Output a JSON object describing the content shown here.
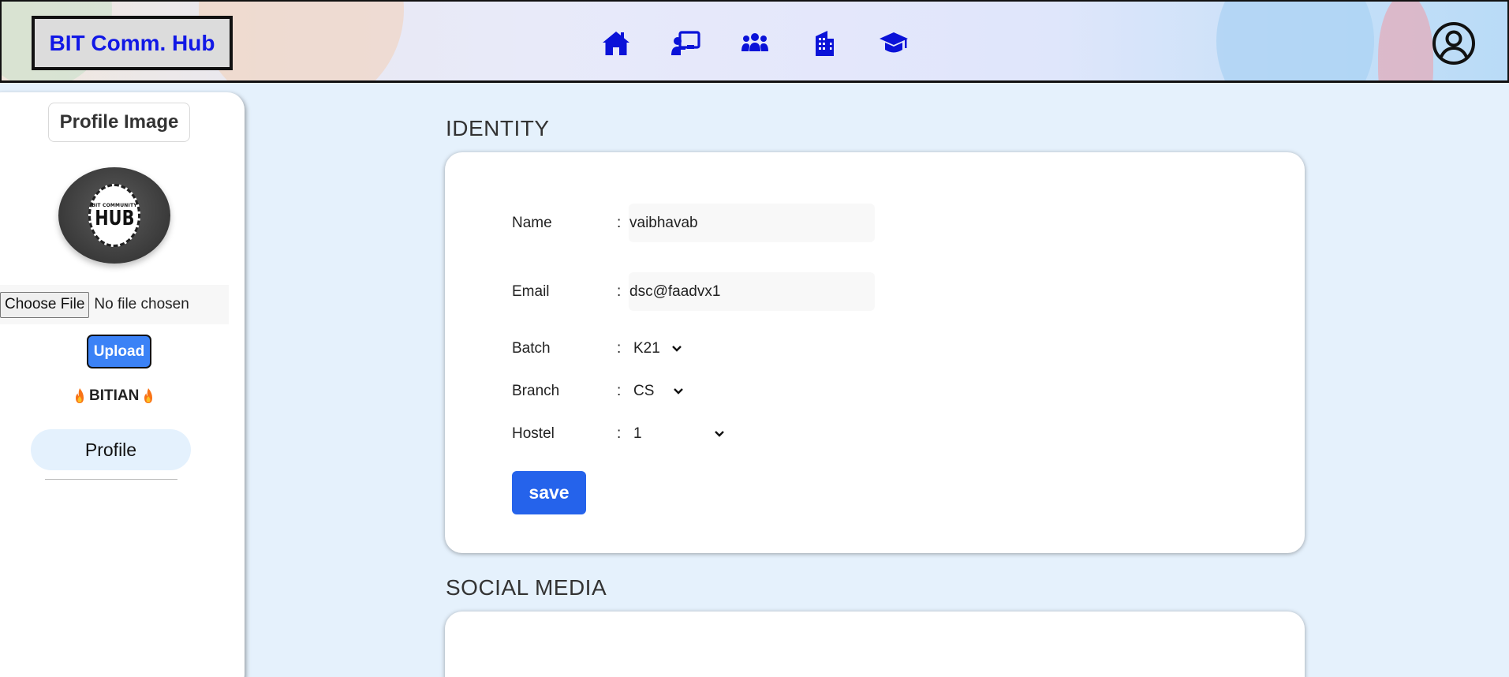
{
  "header": {
    "brand": "BIT Comm. Hub",
    "nav_icons": [
      "home-icon",
      "classroom-icon",
      "community-icon",
      "building-icon",
      "graduation-cap-icon"
    ],
    "account_icon": "user-circle-icon"
  },
  "sidebar": {
    "profile_image_title": "Profile Image",
    "avatar_text_small": "BIT COMMUNITY",
    "avatar_text_big": "HUB",
    "choose_file_label": "Choose File",
    "no_file_text": "No file chosen",
    "upload_label": "Upload",
    "badge_text": "BITIAN",
    "profile_label": "Profile"
  },
  "identity": {
    "title": "IDENTITY",
    "name_label": "Name",
    "name_value": "vaibhavab",
    "email_label": "Email",
    "email_value": "dsc@faadvx1",
    "batch_label": "Batch",
    "batch_value": "K21",
    "branch_label": "Branch",
    "branch_value": "CS",
    "hostel_label": "Hostel",
    "hostel_value": "1",
    "colon": ":",
    "save_label": "save"
  },
  "social": {
    "title": "SOCIAL MEDIA"
  },
  "colors": {
    "brand_text": "#1118e6",
    "nav_icon": "#0a12d8",
    "upload_button": "#3b82f6",
    "save_button": "#2563eb",
    "page_background": "#e5f1fc"
  }
}
